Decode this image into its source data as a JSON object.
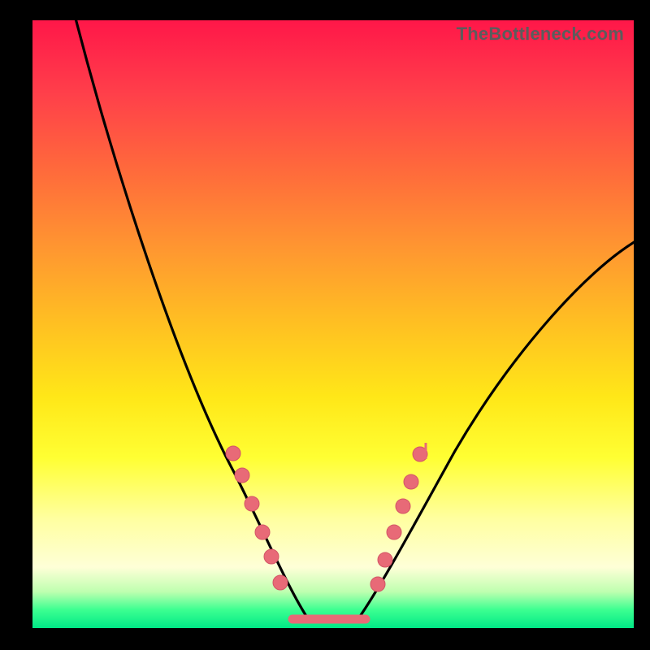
{
  "watermark": "TheBottleneck.com",
  "colors": {
    "background": "#000000",
    "curve": "#000000",
    "marker": "#e86a77",
    "gradient_top": "#ff1749",
    "gradient_bottom": "#00e886"
  },
  "chart_data": {
    "type": "line",
    "title": "",
    "xlabel": "",
    "ylabel": "",
    "xlim": [
      0,
      100
    ],
    "ylim": [
      0,
      100
    ],
    "series": [
      {
        "name": "bottleneck-curve",
        "x": [
          7,
          10,
          15,
          20,
          25,
          30,
          33,
          35,
          37,
          39,
          41,
          43,
          45,
          47,
          50,
          53,
          55,
          57,
          60,
          63,
          68,
          75,
          85,
          95,
          100
        ],
        "y": [
          100,
          93,
          80,
          67,
          54,
          41,
          33,
          28,
          23,
          18,
          12,
          6,
          2,
          0,
          0,
          0,
          2,
          6,
          12,
          18,
          26,
          36,
          48,
          58,
          62
        ]
      }
    ],
    "markers": {
      "left_cluster": [
        [
          33,
          30
        ],
        [
          35,
          26
        ],
        [
          36,
          21
        ],
        [
          38,
          16
        ],
        [
          39,
          12
        ],
        [
          41,
          8
        ]
      ],
      "right_cluster": [
        [
          57,
          8
        ],
        [
          58,
          12
        ],
        [
          60,
          17
        ],
        [
          61,
          21
        ],
        [
          62,
          25
        ],
        [
          64,
          30
        ]
      ],
      "flat_segment": {
        "x_start": 44,
        "x_end": 55,
        "y": 1
      }
    }
  }
}
